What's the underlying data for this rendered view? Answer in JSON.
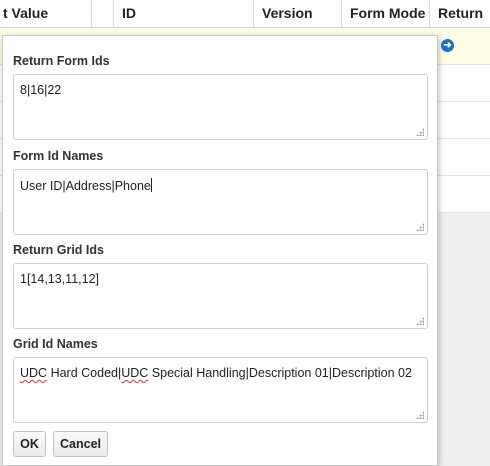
{
  "grid": {
    "columns": [
      {
        "label": "t Value"
      },
      {
        "label": "ID"
      },
      {
        "label": "Version"
      },
      {
        "label": "Form Mode"
      },
      {
        "label": "Return"
      }
    ],
    "selected_row_icon": "return-arrow-icon",
    "accent": "#1a73c9"
  },
  "dialog": {
    "fields": [
      {
        "label": "Return Form Ids",
        "value": "8|16|22"
      },
      {
        "label": "Form Id Names",
        "value": "User ID|Address|Phone"
      },
      {
        "label": "Return Grid Ids",
        "value": "1[14,13,11,12]"
      },
      {
        "label": "Grid Id Names",
        "value_parts": [
          "UDC",
          " Hard Coded|",
          "UDC",
          " Special Handling|Description 01|Description 02"
        ]
      }
    ],
    "buttons": {
      "ok": "OK",
      "cancel": "Cancel"
    }
  }
}
